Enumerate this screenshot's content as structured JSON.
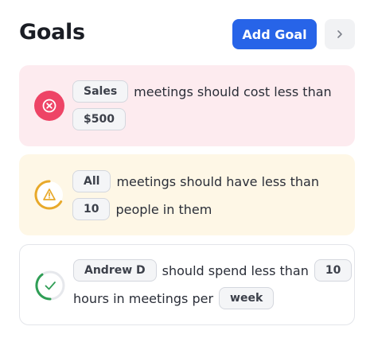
{
  "header": {
    "title": "Goals",
    "add_goal_label": "Add Goal",
    "next_icon": "chevron-right-icon"
  },
  "goals": [
    {
      "status": "failed",
      "icon": "x-circle-icon",
      "color": "#ee4466",
      "background": "#fdebef",
      "chip_1": "Sales",
      "text_1": "meetings should cost less than",
      "chip_2": "$500"
    },
    {
      "status": "warning",
      "icon": "warning-triangle-icon",
      "color": "#e8a92a",
      "background": "#fef7e6",
      "chip_1": "All",
      "text_1": "meetings should have less than",
      "chip_2": "10",
      "text_2": "people in them"
    },
    {
      "status": "success",
      "icon": "check-icon",
      "color": "#2f9e55",
      "background": "#ffffff",
      "chip_1": "Andrew D",
      "text_1": "should spend less than",
      "chip_2": "10",
      "text_2": "hours in meetings per",
      "chip_3": "week"
    }
  ],
  "colors": {
    "accent": "#2764e8",
    "danger": "#ee4466",
    "warning": "#e8a92a",
    "success": "#2f9e55"
  }
}
